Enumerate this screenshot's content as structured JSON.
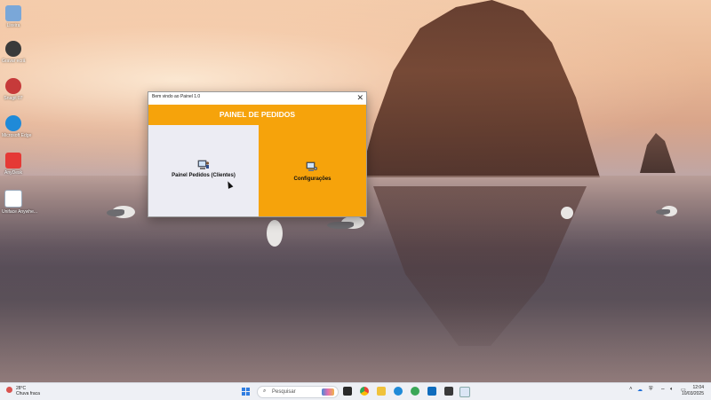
{
  "desktop": {
    "icons": [
      {
        "label": "Lixeira",
        "icon": "recycle-bin-icon",
        "color": "#7aa7d8"
      },
      {
        "label": "Gravar ecrã",
        "icon": "screen-record-icon",
        "color": "#3a3a3a"
      },
      {
        "label": "Snagit 07",
        "icon": "snagit-icon",
        "color": "#c63a3a"
      },
      {
        "label": "Microsoft Edge",
        "icon": "edge-icon",
        "color": "#1f8ad8"
      },
      {
        "label": "AnyDesk",
        "icon": "anydesk-icon",
        "color": "#e53935"
      },
      {
        "label": "Uniface Anywhe...",
        "icon": "uniface-icon",
        "color": "#ffffff"
      }
    ]
  },
  "window": {
    "title": "Bem vindo ao Painel 1.0",
    "banner": "PAINEL DE PEDIDOS",
    "accent": "#f6a30b",
    "panels": [
      {
        "label": "Painel Pedidos (Clientes)",
        "icon": "computer-user-icon"
      },
      {
        "label": "Configurações",
        "icon": "settings-computer-icon"
      }
    ]
  },
  "taskbar": {
    "weather": {
      "temp": "28°C",
      "desc": "Chuva fraca"
    },
    "search_placeholder": "Pesquisar",
    "clock": {
      "time": "12:04",
      "date": "10/03/2025"
    }
  }
}
